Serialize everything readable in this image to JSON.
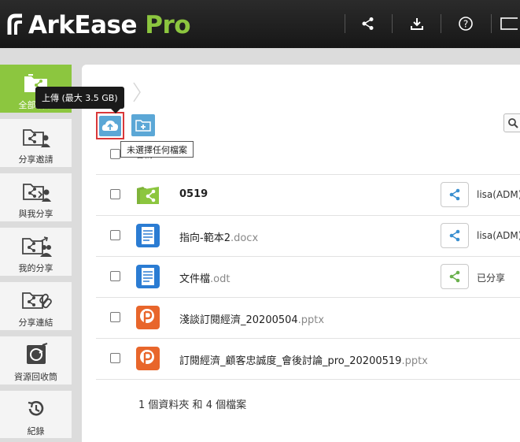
{
  "app": {
    "logo_text_main": "ArkEase",
    "logo_text_pro": "Pro"
  },
  "topbar": {
    "icons": [
      "share-icon",
      "download-icon",
      "help-icon",
      "window-icon"
    ]
  },
  "sidebar": {
    "items": [
      {
        "label": "全部檔案",
        "icon": "all-files-icon",
        "active": true
      },
      {
        "label": "分享邀請",
        "icon": "share-invite-icon",
        "active": false
      },
      {
        "label": "與我分享",
        "icon": "shared-with-me-icon",
        "active": false
      },
      {
        "label": "我的分享",
        "icon": "my-shares-icon",
        "active": false
      },
      {
        "label": "分享連結",
        "icon": "share-link-icon",
        "active": false
      },
      {
        "label": "資源回收筒",
        "icon": "recycle-bin-icon",
        "active": false
      },
      {
        "label": "紀錄",
        "icon": "history-icon",
        "active": false
      }
    ]
  },
  "toolbar": {
    "upload_tooltip": "上傳 (最大 3.5 GB)",
    "selection_tooltip": "未選擇任何檔案"
  },
  "table": {
    "header_name": "名稱",
    "rows": [
      {
        "name": "0519",
        "ext": "",
        "type": "shared-folder",
        "bold": true,
        "share_color": "#3a8fd0",
        "owner": "lisa(ADM)"
      },
      {
        "name": "指向-範本2",
        "ext": ".docx",
        "type": "docx",
        "bold": false,
        "share_color": "#3a8fd0",
        "owner": "lisa(ADM)"
      },
      {
        "name": "文件檔",
        "ext": ".odt",
        "type": "odt",
        "bold": false,
        "share_color": "#6ab04c",
        "owner": "已分享"
      },
      {
        "name": "淺談訂閱經濟_20200504",
        "ext": ".pptx",
        "type": "pptx",
        "bold": false,
        "share_color": "",
        "owner": ""
      },
      {
        "name": "訂閱經濟_顧客忠誠度_會後討論_pro_20200519",
        "ext": ".pptx",
        "type": "pptx",
        "bold": false,
        "share_color": "",
        "owner": ""
      }
    ]
  },
  "summary": {
    "folder_count": "1",
    "folder_text": " 個資料夾 和 ",
    "file_count": "4",
    "file_text": " 個檔案"
  },
  "colors": {
    "accent_green": "#8cc63f",
    "accent_blue": "#5ba7d6",
    "highlight_red": "#d9383a"
  }
}
